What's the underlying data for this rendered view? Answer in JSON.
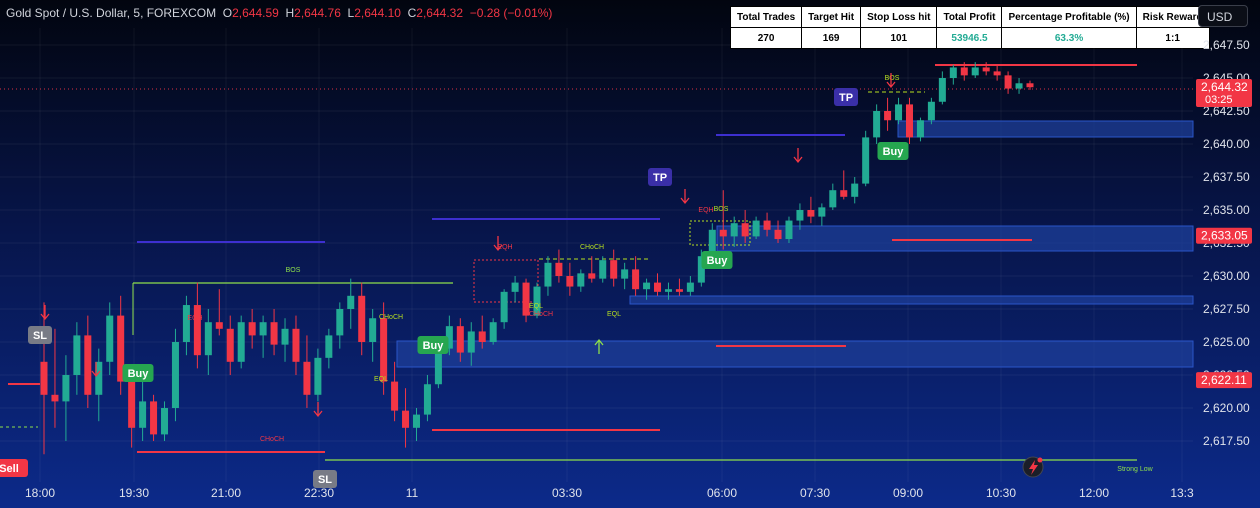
{
  "header": {
    "symbol": "Gold Spot / U.S. Dollar, 5, FOREXCOM",
    "o_label": "O",
    "o_value": "2,644.59",
    "h_label": "H",
    "h_value": "2,644.76",
    "l_label": "L",
    "l_value": "2,644.10",
    "c_label": "C",
    "c_value": "2,644.32",
    "change": "−0.28 (−0.01%)"
  },
  "stats_table": {
    "headers": [
      "Total Trades",
      "Target Hit",
      "Stop Loss hit",
      "Total Profit",
      "Percentage Profitable (%)",
      "Risk Reward"
    ],
    "values": [
      "270",
      "169",
      "101",
      "53946.5",
      "63.3%",
      "1:1"
    ]
  },
  "currency_button": "USD",
  "colors": {
    "up": "#22ab94",
    "down": "#f23645",
    "zone": "#1e3f9a",
    "line": "#3d2fd0"
  },
  "chart_data": {
    "type": "candlestick",
    "x_ticks": [
      "18:00",
      "19:30",
      "21:00",
      "22:30",
      "11",
      "03:30",
      "06:00",
      "07:30",
      "09:00",
      "10:30",
      "12:00",
      "13:3"
    ],
    "y_ticks": [
      2647.5,
      2645.0,
      2642.5,
      2640.0,
      2637.5,
      2635.0,
      2632.5,
      2630.0,
      2627.5,
      2625.0,
      2622.5,
      2620.0,
      2617.5
    ],
    "y_tick_labels": [
      "2,647.50",
      "2,645.00",
      "2,642.50",
      "2,640.00",
      "2,637.50",
      "2,635.00",
      "2,632.50",
      "2,630.00",
      "2,627.50",
      "2,625.00",
      "2,622.50",
      "2,620.00",
      "2,617.50"
    ],
    "ylim": [
      2616.2,
      2648.4
    ],
    "grid": true,
    "price_badges": [
      {
        "price": 2644.32,
        "label": "2,644.32",
        "sublabel": "03:25"
      },
      {
        "price": 2633.05,
        "label": "2,633.05"
      },
      {
        "price": 2622.11,
        "label": "2,622.11"
      }
    ],
    "candles": [
      [
        2623.5,
        2628,
        2616.5,
        2621
      ],
      [
        2621,
        2626,
        2618.5,
        2620.5
      ],
      [
        2620.5,
        2624,
        2617.5,
        2622.5
      ],
      [
        2622.5,
        2626.5,
        2621,
        2625.5
      ],
      [
        2625.5,
        2627,
        2620,
        2621
      ],
      [
        2621,
        2624.5,
        2619,
        2623.5
      ],
      [
        2623.5,
        2628,
        2622.5,
        2627
      ],
      [
        2627,
        2628.5,
        2621,
        2622
      ],
      [
        2622,
        2623,
        2617,
        2618.5
      ],
      [
        2618.5,
        2622,
        2617.5,
        2620.5
      ],
      [
        2620.5,
        2621,
        2617.5,
        2618
      ],
      [
        2618,
        2620.5,
        2617.5,
        2620
      ],
      [
        2620,
        2626,
        2619,
        2625
      ],
      [
        2625,
        2628.5,
        2624,
        2627.8
      ],
      [
        2627.8,
        2629.5,
        2623,
        2624
      ],
      [
        2624,
        2627.5,
        2622.5,
        2626.5
      ],
      [
        2626.5,
        2629,
        2625.5,
        2626
      ],
      [
        2626,
        2627,
        2622.5,
        2623.5
      ],
      [
        2623.5,
        2627,
        2623,
        2626.5
      ],
      [
        2626.5,
        2627.5,
        2624.5,
        2625.5
      ],
      [
        2625.5,
        2627,
        2623.8,
        2626.5
      ],
      [
        2626.5,
        2627.5,
        2624,
        2624.8
      ],
      [
        2624.8,
        2626.8,
        2623.5,
        2626
      ],
      [
        2626,
        2627,
        2622.5,
        2623.5
      ],
      [
        2623.5,
        2625.5,
        2620,
        2621
      ],
      [
        2621,
        2624.5,
        2620.5,
        2623.8
      ],
      [
        2623.8,
        2626,
        2623,
        2625.5
      ],
      [
        2625.5,
        2628,
        2624.5,
        2627.5
      ],
      [
        2627.5,
        2629.8,
        2626,
        2628.5
      ],
      [
        2628.5,
        2629.5,
        2624,
        2625
      ],
      [
        2625,
        2627.5,
        2623.5,
        2626.8
      ],
      [
        2626.8,
        2628,
        2621,
        2622
      ],
      [
        2622,
        2623.5,
        2619,
        2619.8
      ],
      [
        2619.8,
        2621.5,
        2617,
        2618.5
      ],
      [
        2618.5,
        2620,
        2617.5,
        2619.5
      ],
      [
        2619.5,
        2622.5,
        2619,
        2621.8
      ],
      [
        2621.8,
        2625,
        2621.5,
        2624.5
      ],
      [
        2624.5,
        2627,
        2624,
        2626.2
      ],
      [
        2626.2,
        2626.8,
        2623.5,
        2624.2
      ],
      [
        2624.2,
        2626.5,
        2623.2,
        2625.8
      ],
      [
        2625.8,
        2627,
        2624.5,
        2625
      ],
      [
        2625,
        2626.8,
        2624.8,
        2626.5
      ],
      [
        2626.5,
        2629,
        2626,
        2628.8
      ],
      [
        2628.8,
        2630,
        2628,
        2629.5
      ],
      [
        2629.5,
        2629.8,
        2626.5,
        2627
      ],
      [
        2627,
        2629.5,
        2626.8,
        2629.2
      ],
      [
        2629.2,
        2631.5,
        2628.5,
        2631
      ],
      [
        2631,
        2632,
        2629.5,
        2630
      ],
      [
        2630,
        2631,
        2628.5,
        2629.2
      ],
      [
        2629.2,
        2630.5,
        2628.8,
        2630.2
      ],
      [
        2630.2,
        2631.5,
        2629.5,
        2629.8
      ],
      [
        2629.8,
        2631.5,
        2629.5,
        2631.2
      ],
      [
        2631.2,
        2632,
        2629.2,
        2629.8
      ],
      [
        2629.8,
        2631,
        2629,
        2630.5
      ],
      [
        2630.5,
        2631.5,
        2628.5,
        2629
      ],
      [
        2629,
        2629.8,
        2628.2,
        2629.5
      ],
      [
        2629.5,
        2630.2,
        2628.5,
        2628.8
      ],
      [
        2628.8,
        2629.5,
        2628.2,
        2629
      ],
      [
        2629,
        2629.8,
        2628.5,
        2628.8
      ],
      [
        2628.8,
        2630,
        2628.5,
        2629.5
      ],
      [
        2629.5,
        2632,
        2629.2,
        2631.5
      ],
      [
        2631.5,
        2634,
        2631,
        2633.5
      ],
      [
        2633.5,
        2636.5,
        2632,
        2633
      ],
      [
        2633,
        2634.5,
        2632.2,
        2634
      ],
      [
        2634,
        2635,
        2632.5,
        2633
      ],
      [
        2633,
        2634.5,
        2632.8,
        2634.2
      ],
      [
        2634.2,
        2634.8,
        2633,
        2633.5
      ],
      [
        2633.5,
        2634.2,
        2632.5,
        2632.8
      ],
      [
        2632.8,
        2634.5,
        2632.5,
        2634.2
      ],
      [
        2634.2,
        2635.5,
        2633.5,
        2635
      ],
      [
        2635,
        2636,
        2634,
        2634.5
      ],
      [
        2634.5,
        2635.5,
        2633.8,
        2635.2
      ],
      [
        2635.2,
        2637,
        2635,
        2636.5
      ],
      [
        2636.5,
        2638,
        2635.8,
        2636
      ],
      [
        2636,
        2637.5,
        2635.5,
        2637
      ],
      [
        2637,
        2641,
        2636.8,
        2640.5
      ],
      [
        2640.5,
        2643,
        2640,
        2642.5
      ],
      [
        2642.5,
        2643.5,
        2641,
        2641.8
      ],
      [
        2641.8,
        2643.5,
        2641.5,
        2643
      ],
      [
        2643,
        2643.5,
        2640,
        2640.5
      ],
      [
        2640.5,
        2642,
        2640.2,
        2641.8
      ],
      [
        2641.8,
        2643.5,
        2641.5,
        2643.2
      ],
      [
        2643.2,
        2645.5,
        2643,
        2645
      ],
      [
        2645,
        2646,
        2644.5,
        2645.8
      ],
      [
        2645.8,
        2646.2,
        2644.8,
        2645.2
      ],
      [
        2645.2,
        2646.2,
        2645,
        2645.8
      ],
      [
        2645.8,
        2646.2,
        2645.2,
        2645.5
      ],
      [
        2645.5,
        2646,
        2644.8,
        2645.2
      ],
      [
        2645.2,
        2645.5,
        2643.8,
        2644.2
      ],
      [
        2644.2,
        2645,
        2643.8,
        2644.6
      ],
      [
        2644.6,
        2644.8,
        2644.1,
        2644.3
      ]
    ],
    "labels": [
      "SL",
      "Buy",
      "BOS",
      "EQH",
      "CHoCH",
      "EQL",
      "Buy",
      "CHoCH",
      "EQH",
      "EQL",
      "CHoCH",
      "EQL",
      "TP",
      "EQH",
      "BOS",
      "Buy",
      "TP",
      "BOS",
      "Buy",
      "Sell",
      "SL",
      "Strong Low",
      "CHoCH"
    ]
  }
}
